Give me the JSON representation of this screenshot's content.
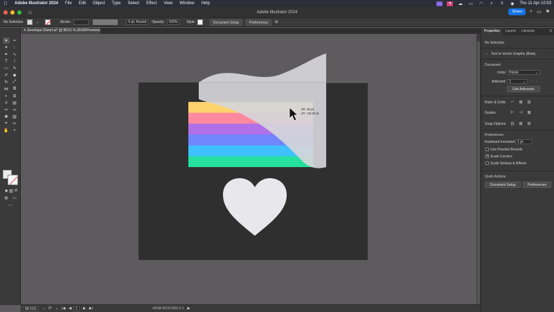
{
  "menubar": {
    "apple": "",
    "app_name": "Adobe Illustrator 2024",
    "items": [
      "File",
      "Edit",
      "Object",
      "Type",
      "Select",
      "Effect",
      "View",
      "Window",
      "Help"
    ],
    "clock": "Thu 11 Apr  10:53"
  },
  "titlebar": {
    "title": "Adobe Illustrator 2024",
    "share_label": "Share"
  },
  "controlbar": {
    "selection_state": "No Selection",
    "stroke_label": "Stroke:",
    "brush_value": "5 pt. Round",
    "opacity_label": "Opacity:",
    "opacity_value": "100%",
    "style_label": "Style:",
    "document_setup": "Document Setup",
    "preferences": "Preferences"
  },
  "document_tab": {
    "label": "Envelope Distort.ai* @ 88.61 % (RGB/Preview)"
  },
  "canvas": {
    "cursor_readout_dx": "dX: 36 pt",
    "cursor_readout_dy": "dY: -63.02 pt",
    "gradient_colors": [
      "#ffd36b",
      "#ff8aa0",
      "#b070e8",
      "#6f86ff",
      "#3fc0ff",
      "#26e0a0"
    ],
    "heart_color": "#e8e8ec",
    "artboard_color": "#2f2f2f",
    "envelope_color": "#d6d6da"
  },
  "statusbar": {
    "zoom": "88.61%",
    "rotation": "0°",
    "artboard_index": "1",
    "color_profile": "sRGB IEC61966-2.1"
  },
  "panel": {
    "tabs": [
      "Properties",
      "Layers",
      "Libraries"
    ],
    "no_selection": "No Selection",
    "text_to_vector": "Text to Vector Graphic (Beta)",
    "document_header": "Document",
    "units_label": "Units:",
    "units_value": "Points",
    "artboard_label": "Artboard:",
    "artboard_value": "1",
    "edit_artboards": "Edit Artboards",
    "ruler_grids": "Ruler & Grids",
    "guides": "Guides",
    "snap_options": "Snap Options",
    "preferences_header": "Preferences",
    "keyboard_increment_label": "Keyboard Increment:",
    "keyboard_increment_value": "1 pt",
    "use_preview_bounds": "Use Preview Bounds",
    "scale_corners": "Scale Corners",
    "scale_strokes": "Scale Strokes & Effects",
    "quick_actions": "Quick Actions",
    "qa_document_setup": "Document Setup",
    "qa_preferences": "Preferences"
  }
}
